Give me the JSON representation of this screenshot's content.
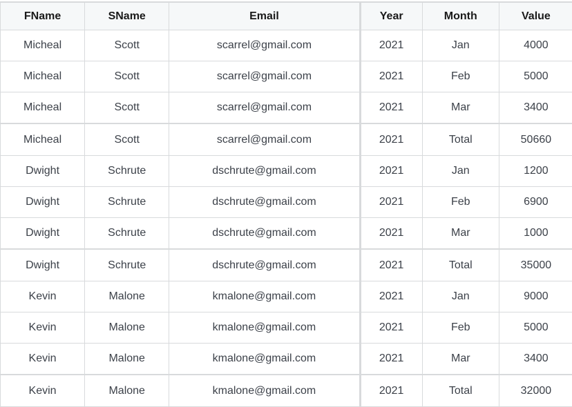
{
  "table": {
    "headers": [
      "FName",
      "SName",
      "Email",
      "Year",
      "Month",
      "Value"
    ],
    "rows": [
      {
        "fname": "Micheal",
        "sname": "Scott",
        "email": "scarrel@gmail.com",
        "year": "2021",
        "month": "Jan",
        "value": "4000"
      },
      {
        "fname": "Micheal",
        "sname": "Scott",
        "email": "scarrel@gmail.com",
        "year": "2021",
        "month": "Feb",
        "value": "5000"
      },
      {
        "fname": "Micheal",
        "sname": "Scott",
        "email": "scarrel@gmail.com",
        "year": "2021",
        "month": "Mar",
        "value": "3400"
      },
      {
        "fname": "Micheal",
        "sname": "Scott",
        "email": "scarrel@gmail.com",
        "year": "2021",
        "month": "Total",
        "value": "50660"
      },
      {
        "fname": "Dwight",
        "sname": "Schrute",
        "email": "dschrute@gmail.com",
        "year": "2021",
        "month": "Jan",
        "value": "1200"
      },
      {
        "fname": "Dwight",
        "sname": "Schrute",
        "email": "dschrute@gmail.com",
        "year": "2021",
        "month": "Feb",
        "value": "6900"
      },
      {
        "fname": "Dwight",
        "sname": "Schrute",
        "email": "dschrute@gmail.com",
        "year": "2021",
        "month": "Mar",
        "value": "1000"
      },
      {
        "fname": "Dwight",
        "sname": "Schrute",
        "email": "dschrute@gmail.com",
        "year": "2021",
        "month": "Total",
        "value": "35000"
      },
      {
        "fname": "Kevin",
        "sname": "Malone",
        "email": "kmalone@gmail.com",
        "year": "2021",
        "month": "Jan",
        "value": "9000"
      },
      {
        "fname": "Kevin",
        "sname": "Malone",
        "email": "kmalone@gmail.com",
        "year": "2021",
        "month": "Feb",
        "value": "5000"
      },
      {
        "fname": "Kevin",
        "sname": "Malone",
        "email": "kmalone@gmail.com",
        "year": "2021",
        "month": "Mar",
        "value": "3400"
      },
      {
        "fname": "Kevin",
        "sname": "Malone",
        "email": "kmalone@gmail.com",
        "year": "2021",
        "month": "Total",
        "value": "32000"
      }
    ]
  }
}
